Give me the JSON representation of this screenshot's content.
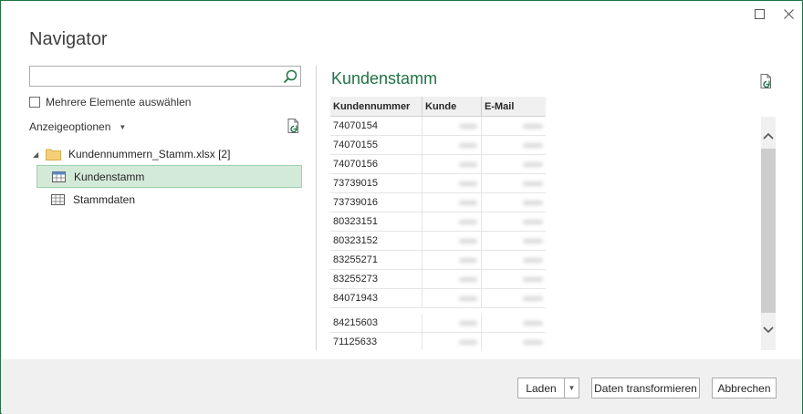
{
  "window": {
    "title": "Navigator",
    "maximize_icon": "maximize-icon",
    "close_icon": "close-icon"
  },
  "left_pane": {
    "search": {
      "value": "",
      "placeholder": "",
      "icon": "search-icon"
    },
    "multi_select": {
      "label": "Mehrere Elemente auswählen",
      "checked": false
    },
    "display_options": {
      "label": "Anzeigeoptionen",
      "icon": "caret-down-icon"
    },
    "refresh_icon": "refresh-icon",
    "tree": {
      "root": {
        "label": "Kundennummern_Stamm.xlsx [2]",
        "icon": "folder-icon",
        "expanded": true
      },
      "items": [
        {
          "label": "Kundenstamm",
          "icon": "table-icon",
          "selected": true
        },
        {
          "label": "Stammdaten",
          "icon": "sheet-icon",
          "selected": false
        }
      ]
    }
  },
  "preview": {
    "title": "Kundenstamm",
    "refresh_icon": "refresh-icon",
    "columns": [
      "Kundennummer",
      "Kunde",
      "E-Mail"
    ],
    "rows": [
      "74070154",
      "74070155",
      "74070156",
      "73739015",
      "73739016",
      "80323151",
      "80323152",
      "83255271",
      "83255273",
      "84071943",
      "84215603",
      "71125633"
    ]
  },
  "footer": {
    "load_label": "Laden",
    "transform_label": "Daten transformieren",
    "cancel_label": "Abbrechen"
  },
  "colors": {
    "accent": "#217346",
    "selection_bg": "#d4ead9",
    "selection_border": "#9fd0ad",
    "footer_bg": "#f0f0f0"
  }
}
